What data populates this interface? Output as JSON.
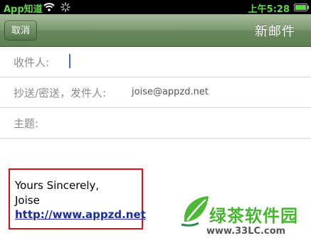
{
  "status_bar": {
    "carrier": "App知道",
    "time": "上午5:28"
  },
  "nav_bar": {
    "cancel_label": "取消",
    "title": "新邮件"
  },
  "fields": {
    "to_label": "收件人:",
    "cc_from_label": "抄送/密送，发件人:",
    "from_value": "joise@appzd.net",
    "subject_label": "主题:"
  },
  "body": {
    "signature_line1": "Yours Sincerely,",
    "signature_line2": "Joise",
    "signature_link": "http://www.appzd.net"
  },
  "watermark": {
    "title": "绿茶软件园",
    "url": "www.33LC.com"
  },
  "colors": {
    "status_text": "#62d64a",
    "nav_bar": "#6b8a5f",
    "highlight_border": "#d4131c",
    "link": "#1a2c9e",
    "watermark_green": "#46b530"
  }
}
